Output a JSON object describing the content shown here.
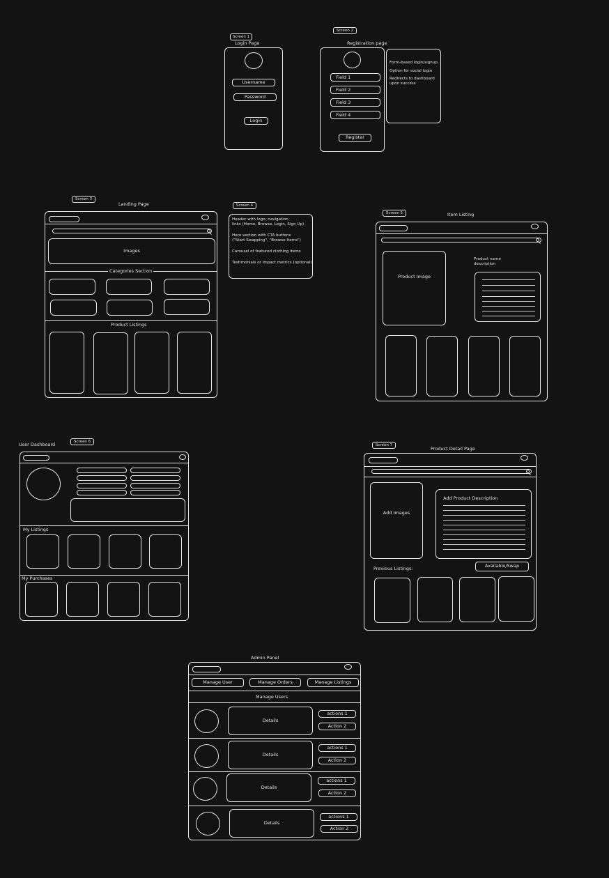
{
  "screen1": {
    "tag": "Screen 1",
    "title": "Login Page",
    "username": "Username",
    "password": "Password",
    "login": "Login"
  },
  "screen2": {
    "tag": "Screen 2",
    "title": "Registration page",
    "fields": [
      "Field 1",
      "Field 2",
      "Field 3",
      "Field 4"
    ],
    "register": "Register",
    "notes": [
      "Form-based login/signup",
      "Option for social login",
      "Redirects to dashboard\nupon success"
    ]
  },
  "screen3": {
    "tag": "Screen 3",
    "title": "Landing Page",
    "images": "Images",
    "categories": "Categories Section",
    "products": "Product Listings"
  },
  "screen4": {
    "tag": "Screen 4",
    "notes": [
      "Header with logo, navigation\nlinks (Home, Browse, Login, Sign Up)",
      "Hero section with CTA buttons\n(\"Start Swapping\", \"Browse Items\")",
      "Carousel of featured clothing items",
      "Testimonials or impact metrics (optional)"
    ]
  },
  "screen5": {
    "tag": "Screen 5",
    "title": "Item Listing",
    "product_image": "Product Image",
    "product_name": "Product name\ndescription"
  },
  "screen6": {
    "tag": "Screen 6",
    "title": "User Dashboard",
    "my_listings": "My Listings",
    "my_purchases": "My Purchases"
  },
  "screen7": {
    "tag": "Screen 7",
    "title": "Product  Detail Page",
    "add_images": "Add Images",
    "add_description": "Add Product Description",
    "available": "Available/Swap",
    "previous_listings": "Previous Listings:"
  },
  "admin": {
    "title": "Admin Panel",
    "tabs": [
      "Manage User",
      "Manage Orders",
      "Manage Listings"
    ],
    "section": "Manage Users",
    "rows": [
      {
        "details": "Details",
        "action1": "actions 1",
        "action2": "Action 2"
      },
      {
        "details": "Details",
        "action1": "actions 1",
        "action2": "Action 2"
      },
      {
        "details": "Details",
        "action1": "actions 1",
        "action2": "Action 2"
      },
      {
        "details": "Details",
        "action1": "actions 1",
        "action2": "Action 2"
      }
    ]
  }
}
